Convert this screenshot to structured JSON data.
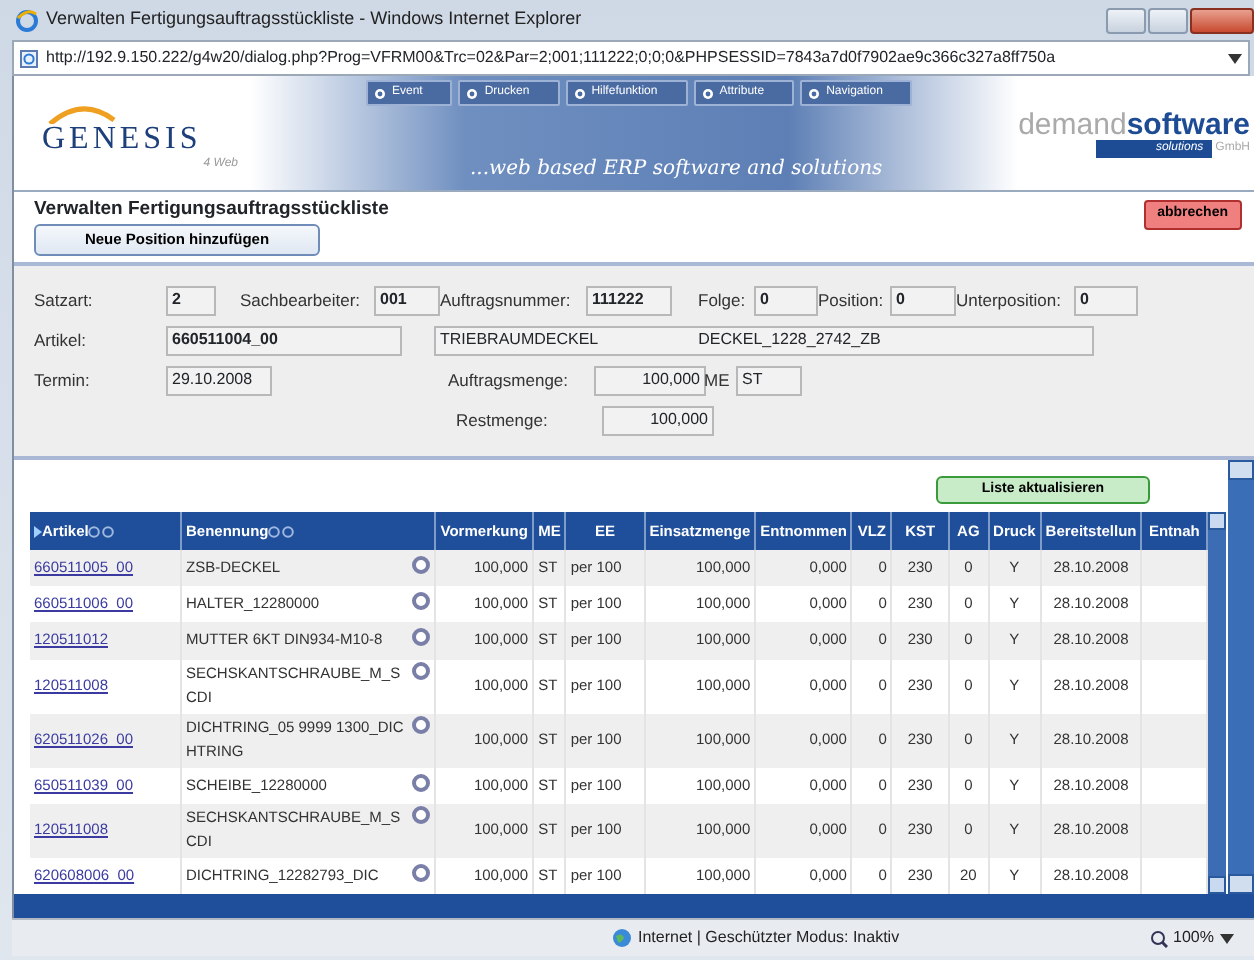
{
  "window": {
    "title": "Verwalten Fertigungsauftragsstückliste - Windows Internet Explorer"
  },
  "address_bar": {
    "url": "http://192.9.150.222/g4w20/dialog.php?Prog=VFRM00&Trc=02&Par=2;001;111222;0;0;0&PHPSESSID=7843a7d0f7902ae9c366c327a8ff750a"
  },
  "header": {
    "menu": [
      "Event",
      "Drucken",
      "Hilfefunktion",
      "Attribute",
      "Navigation"
    ],
    "logo": "GENESIS",
    "logo_sub": "4 Web",
    "slogan": "...web based ERP software and solutions",
    "vendor_light": "demand",
    "vendor_bold": "software",
    "vendor_tag": "solutions",
    "vendor_suffix": "GmbH"
  },
  "page": {
    "title": "Verwalten Fertigungsauftragsstückliste",
    "add_button": "Neue Position hinzufügen",
    "cancel_button": "abbrechen"
  },
  "form": {
    "fields": [
      {
        "kind": "text",
        "label": "Satzart:",
        "value": "2",
        "bold": true
      },
      {
        "kind": "text",
        "label": "Sachbearbeiter:",
        "value": "001",
        "bold": true
      },
      {
        "kind": "text",
        "label": "Auftragsnummer:",
        "value": "111222",
        "bold": true
      },
      {
        "kind": "text",
        "label": "Folge:",
        "value": "0",
        "bold": true
      },
      {
        "kind": "text",
        "label": "Position:",
        "value": "0",
        "bold": true
      },
      {
        "kind": "text",
        "label": "Unterposition:",
        "value": "0",
        "bold": true
      },
      {
        "kind": "text",
        "label": "Artikel:",
        "value": "660511004_00",
        "bold": true
      },
      {
        "kind": "text",
        "values": [
          "TRIEBRAUMDECKEL",
          "DECKEL_1228_2742_ZB"
        ],
        "bold": false
      },
      {
        "kind": "text",
        "label": "Termin:",
        "value": "29.10.2008",
        "bold": false
      },
      {
        "kind": "number",
        "label": "Auftragsmenge:",
        "value": "100,000",
        "bold": false
      },
      {
        "kind": "text",
        "label": "ME",
        "value": "ST",
        "bold": false
      },
      {
        "kind": "number",
        "label": "Restmenge:",
        "value": "100,000",
        "bold": false
      }
    ]
  },
  "table": {
    "refresh_button": "Liste aktualisieren",
    "columns": [
      {
        "label": "Artikel",
        "kind": "link",
        "sortable": true,
        "sorted": true
      },
      {
        "label": "Benennung",
        "kind": "text_action",
        "sortable": true,
        "sorted": false
      },
      {
        "label": "Vormerkung",
        "kind": "number"
      },
      {
        "label": "ME",
        "kind": "text"
      },
      {
        "label": "EE",
        "kind": "text"
      },
      {
        "label": "Einsatzmenge",
        "kind": "number"
      },
      {
        "label": "Entnommen",
        "kind": "number"
      },
      {
        "label": "VLZ",
        "kind": "number"
      },
      {
        "label": "KST",
        "kind": "center"
      },
      {
        "label": "AG",
        "kind": "center"
      },
      {
        "label": "Druck",
        "kind": "center"
      },
      {
        "label": "Bereitstellun",
        "kind": "center"
      },
      {
        "label": "Entnah",
        "kind": "text"
      }
    ],
    "rows": [
      [
        "660511005_00",
        "ZSB-DECKEL",
        "100,000",
        "ST",
        "per 100",
        "100,000",
        "0,000",
        "0",
        "230",
        "0",
        "Y",
        "28.10.2008"
      ],
      [
        "660511006_00",
        "HALTER_12280000",
        "100,000",
        "ST",
        "per 100",
        "100,000",
        "0,000",
        "0",
        "230",
        "0",
        "Y",
        "28.10.2008"
      ],
      [
        "120511012",
        "MUTTER 6KT DIN934-M10-8",
        "100,000",
        "ST",
        "per 100",
        "100,000",
        "0,000",
        "0",
        "230",
        "0",
        "Y",
        "28.10.2008"
      ],
      [
        "120511008",
        "SECHSKANTSCHRAUBE_M_SCDI",
        "100,000",
        "ST",
        "per 100",
        "100,000",
        "0,000",
        "0",
        "230",
        "0",
        "Y",
        "28.10.2008"
      ],
      [
        "620511026_00",
        "DICHTRING_05 9999 1300_DICHTRING",
        "100,000",
        "ST",
        "per 100",
        "100,000",
        "0,000",
        "0",
        "230",
        "0",
        "Y",
        "28.10.2008"
      ],
      [
        "650511039_00",
        "SCHEIBE_12280000",
        "100,000",
        "ST",
        "per 100",
        "100,000",
        "0,000",
        "0",
        "230",
        "0",
        "Y",
        "28.10.2008"
      ],
      [
        "120511008",
        "SECHSKANTSCHRAUBE_M_SCDI",
        "100,000",
        "ST",
        "per 100",
        "100,000",
        "0,000",
        "0",
        "230",
        "0",
        "Y",
        "28.10.2008"
      ],
      [
        "620608006_00",
        "DICHTRING_12282793_DIC",
        "100,000",
        "ST",
        "per 100",
        "100,000",
        "0,000",
        "0",
        "230",
        "20",
        "Y",
        "28.10.2008"
      ]
    ]
  },
  "status_bar": {
    "zone": "Internet | Geschützter Modus: Inaktiv",
    "zoom": "100%"
  }
}
